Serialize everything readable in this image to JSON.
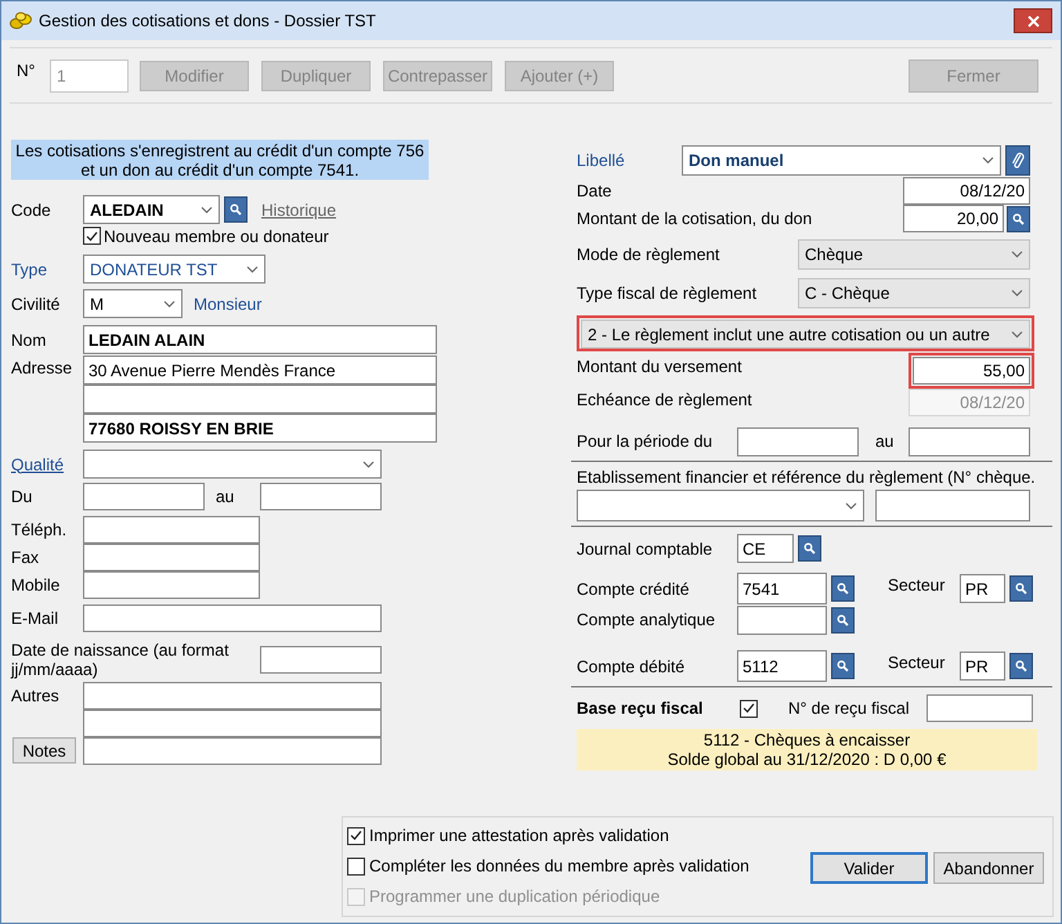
{
  "window": {
    "title": "Gestion des cotisations et dons - Dossier TST"
  },
  "toolbar": {
    "number_label": "N°",
    "number_value": "1",
    "buttons": [
      {
        "label": "Modifier",
        "disabled": true
      },
      {
        "label": "Dupliquer",
        "disabled": true
      },
      {
        "label": "Contrepasser",
        "disabled": true
      },
      {
        "label": "Ajouter (+)",
        "disabled": true
      }
    ],
    "close_button": {
      "label": "Fermer",
      "disabled": true
    }
  },
  "member": {
    "info_banner": "Les cotisations s'enregistrent au crédit d'un compte 756 et un don au crédit d'un compte 7541.",
    "code": {
      "label": "Code",
      "value": "ALEDAIN",
      "link": "Historique"
    },
    "new_member": {
      "label": "Nouveau membre ou donateur",
      "checked": true
    },
    "type": {
      "label": "Type",
      "value": "DONATEUR TST"
    },
    "civility": {
      "label": "Civilité",
      "value": "M",
      "description": "Monsieur"
    },
    "name": {
      "label": "Nom",
      "value": "LEDAIN ALAIN"
    },
    "address": {
      "label": "Adresse",
      "line_1": "30 Avenue Pierre Mendès France",
      "line_3": "77680 ROISSY EN BRIE"
    },
    "quality": {
      "label": "Qualité"
    },
    "period": {
      "from_label": "Du",
      "to_label": "au"
    },
    "phone": {
      "label": "Téléph."
    },
    "fax": {
      "label": "Fax"
    },
    "mobile": {
      "label": "Mobile"
    },
    "email": {
      "label": "E-Mail"
    },
    "birth_date": {
      "label": "Date de naissance (au format jj/mm/aaaa)"
    },
    "other": {
      "label": "Autres"
    },
    "notes_button": "Notes"
  },
  "payment": {
    "label_field": {
      "label": "Libellé",
      "value": "Don manuel"
    },
    "date": {
      "label": "Date",
      "value": "08/12/20"
    },
    "amount": {
      "label": "Montant de la cotisation, du don",
      "value": "20,00"
    },
    "mode": {
      "label": "Mode de règlement",
      "value": "Chèque"
    },
    "fiscal_type": {
      "label": "Type fiscal de règlement",
      "value": "C - Chèque"
    },
    "scope": {
      "value": "2 - Le règlement inclut une autre cotisation ou un autre",
      "highlighted": true
    },
    "paid_amount": {
      "label": "Montant du versement",
      "value": "55,00",
      "highlighted": true
    },
    "due_date": {
      "label": "Echéance de règlement",
      "value": "08/12/20",
      "disabled": true
    },
    "period": {
      "label": "Pour la période du",
      "to_label": "au"
    },
    "bank": {
      "label": "Etablissement financier et référence du règlement (N° chèque."
    },
    "journal": {
      "label": "Journal comptable",
      "value": "CE"
    },
    "credit_account": {
      "label": "Compte crédité",
      "value": "7541",
      "sector_label": "Secteur",
      "sector": "PR"
    },
    "analytic_account": {
      "label": "Compte analytique"
    },
    "debit_account": {
      "label": "Compte débité",
      "value": "5112",
      "sector_label": "Secteur",
      "sector": "PR"
    },
    "tax_receipt": {
      "label": "Base reçu fiscal",
      "checked": true,
      "number_label": "N° de reçu fiscal"
    },
    "account_info": [
      "5112 - Chèques à encaisser",
      "Solde global au 31/12/2020 : D 0,00 €"
    ]
  },
  "options": [
    {
      "label": "Imprimer une attestation après validation",
      "checked": true,
      "disabled": false
    },
    {
      "label": "Compléter les données du membre après validation",
      "checked": false,
      "disabled": false
    },
    {
      "label": "Programmer une duplication périodique",
      "checked": false,
      "disabled": true
    }
  ],
  "actions": [
    {
      "label": "Valider",
      "default": true
    },
    {
      "label": "Abandonner",
      "default": false
    }
  ]
}
